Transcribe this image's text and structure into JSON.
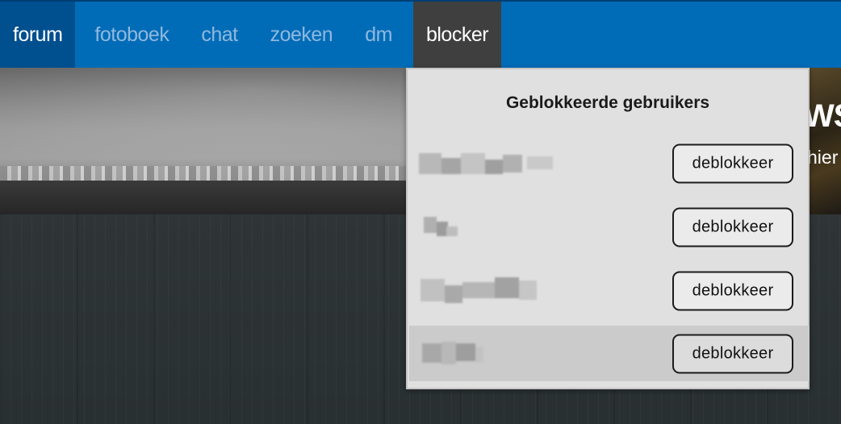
{
  "nav": {
    "items": [
      {
        "label": "forum",
        "state": "active"
      },
      {
        "label": "fotoboek",
        "state": "normal"
      },
      {
        "label": "chat",
        "state": "normal"
      },
      {
        "label": "zoeken",
        "state": "normal"
      },
      {
        "label": "dm",
        "state": "normal"
      },
      {
        "label": "blocker",
        "state": "open"
      }
    ]
  },
  "hero": {
    "title_fragment": "WS",
    "subtitle_fragment": "hier"
  },
  "blocker": {
    "title": "Geblokkeerde gebruikers",
    "users": [
      {
        "name": "",
        "button_label": "deblokkeer",
        "hovered": false
      },
      {
        "name": "",
        "button_label": "deblokkeer",
        "hovered": false
      },
      {
        "name": "",
        "button_label": "deblokkeer",
        "hovered": false
      },
      {
        "name": "",
        "button_label": "deblokkeer",
        "hovered": true
      }
    ]
  },
  "colors": {
    "nav_bg": "#006cb7",
    "nav_active_bg": "#004f8f",
    "nav_open_bg": "#3f3f3f",
    "nav_inactive_text": "#8fb8de",
    "dropdown_bg": "#e0e0e0"
  }
}
